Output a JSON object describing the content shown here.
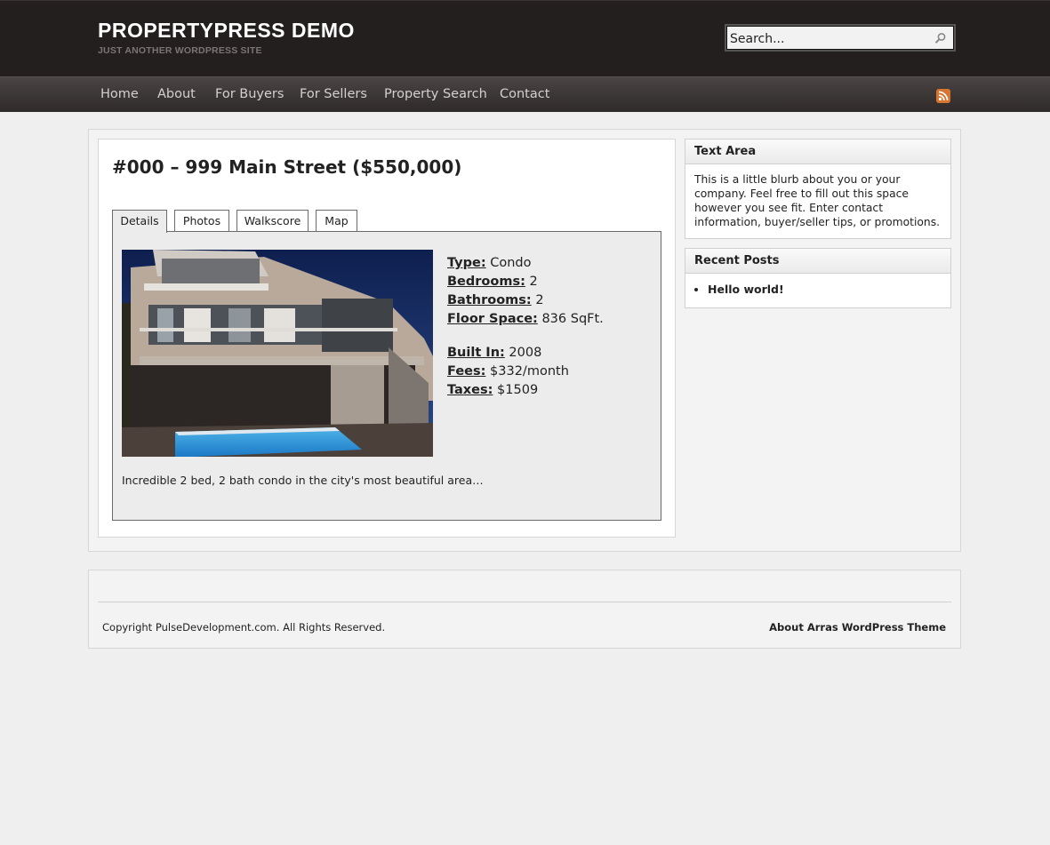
{
  "site": {
    "title": "PROPERTYPRESS DEMO",
    "description": "JUST ANOTHER WORDPRESS SITE"
  },
  "search": {
    "placeholder": "Search..."
  },
  "nav": {
    "items": [
      "Home",
      "About",
      "For Buyers",
      "For Sellers",
      "Property Search",
      "Contact"
    ],
    "rss_icon": "rss-icon"
  },
  "post": {
    "title": "#000 – 999 Main Street ($550,000)",
    "tabs": [
      "Details",
      "Photos",
      "Walkscore",
      "Map"
    ],
    "active_tab": "Details",
    "details": [
      {
        "label": "Type:",
        "value": "Condo"
      },
      {
        "label": "Bedrooms:",
        "value": "2"
      },
      {
        "label": "Bathrooms:",
        "value": "2"
      },
      {
        "label": "Floor Space:",
        "value": "836 SqFt."
      },
      {
        "label": "Built In:",
        "value": "2008"
      },
      {
        "label": "Fees:",
        "value": "$332/month"
      },
      {
        "label": "Taxes:",
        "value": "$1509"
      }
    ],
    "excerpt": "Incredible 2 bed, 2 bath condo in the city's most beautiful area…"
  },
  "sidebar": {
    "text_area": {
      "title": "Text Area",
      "body": "This is a little blurb about you or your company. Feel free to fill out this space however you see fit. Enter contact information, buyer/seller tips, or promotions."
    },
    "recent_posts": {
      "title": "Recent Posts",
      "items": [
        "Hello world!"
      ]
    }
  },
  "footer": {
    "copyright": "Copyright PulseDevelopment.com. All Rights Reserved.",
    "theme_link": "About Arras WordPress Theme"
  },
  "colors": {
    "header_bg": "#231f1e",
    "nav_text": "#d4d0cf",
    "rss_orange": "#d7742f",
    "page_bg": "#efefef"
  }
}
